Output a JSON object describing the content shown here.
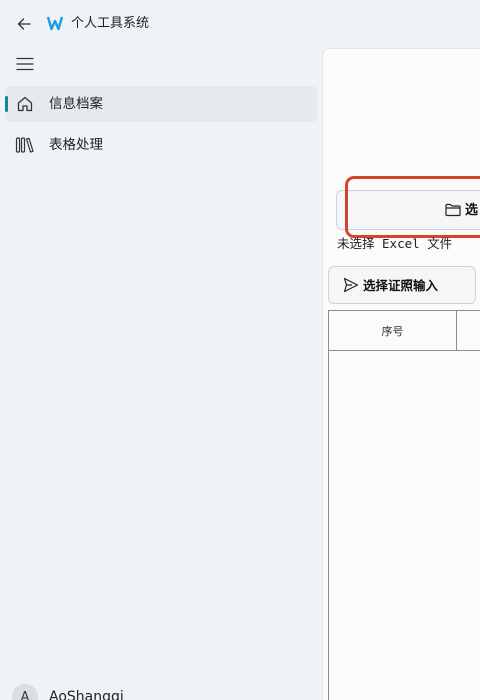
{
  "app": {
    "title": "个人工具系统"
  },
  "nav": {
    "items": [
      {
        "label": "信息档案",
        "icon": "home-icon",
        "active": true
      },
      {
        "label": "表格处理",
        "icon": "library-icon",
        "active": false
      }
    ]
  },
  "user": {
    "avatar_letter": "A",
    "name": "AoShangqi"
  },
  "main": {
    "select_file_button_label": "选",
    "file_status": "未选择 Excel 文件",
    "id_input_button_label": "选择证照输入",
    "table": {
      "columns": [
        "序号"
      ]
    }
  },
  "colors": {
    "accent": "#0a8a96",
    "highlight": "#d9432c",
    "background": "#eff2f7"
  }
}
